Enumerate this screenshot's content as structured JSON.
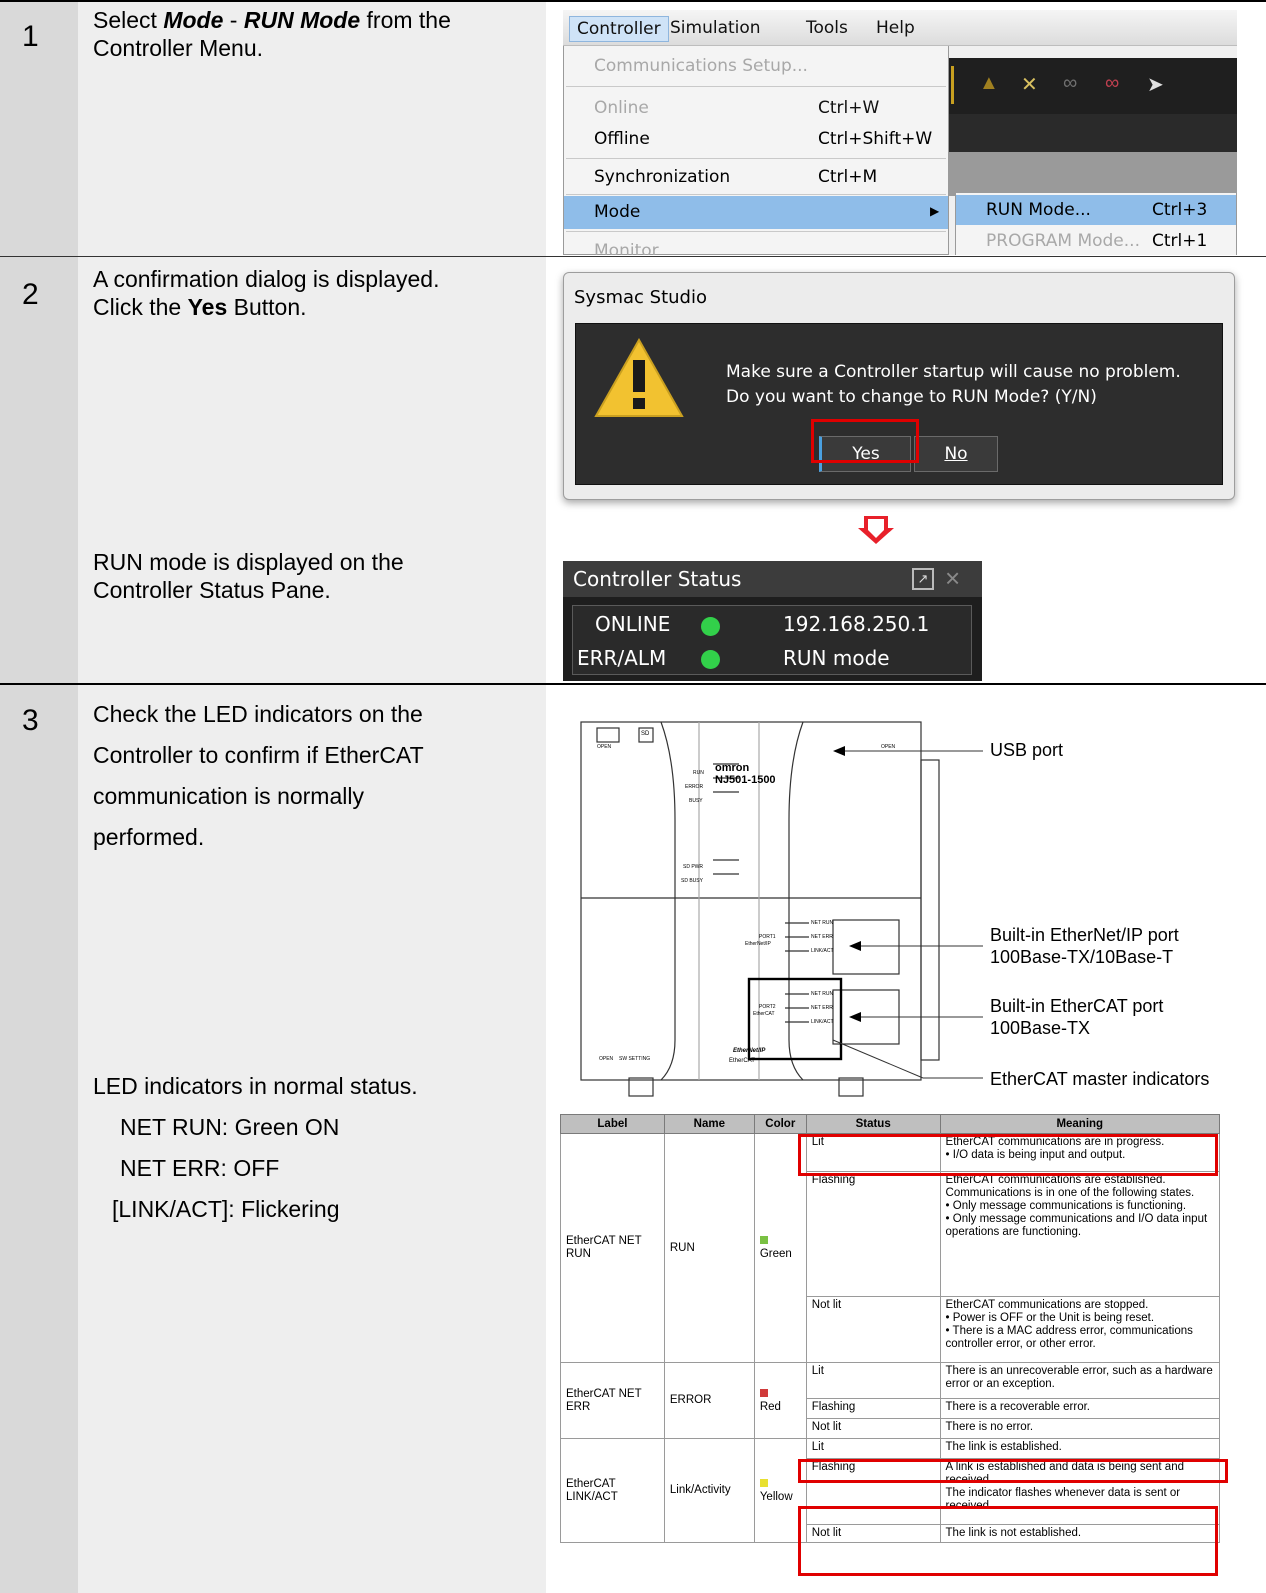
{
  "steps": [
    {
      "number": "1",
      "text_pre": "Select ",
      "text_bold1": "Mode",
      "text_sep": " - ",
      "text_bold2": "RUN Mode",
      "text_post": " from the",
      "text_line2": "Controller Menu."
    },
    {
      "number": "2",
      "text_line1": "A confirmation dialog is displayed.",
      "text_pre": "Click the ",
      "text_bold": "Yes",
      "text_post": " Button.",
      "result_line1": "RUN mode is displayed on the",
      "result_line2": "Controller Status Pane."
    },
    {
      "number": "3",
      "lines": [
        "Check the LED indicators on the",
        "Controller to confirm if EtherCAT",
        "communication is normally",
        "performed."
      ],
      "normal_title": "LED indicators in normal status.",
      "normal_items": [
        "NET RUN: Green ON",
        "NET ERR: OFF",
        "[LINK/ACT]: Flickering"
      ]
    }
  ],
  "menu": {
    "bar": [
      "Controller",
      "Simulation",
      "Tools",
      "Help"
    ],
    "items": [
      {
        "label": "Communications Setup...",
        "shortcut": ""
      },
      {
        "label": "Online",
        "shortcut": "Ctrl+W"
      },
      {
        "label": "Offline",
        "shortcut": "Ctrl+Shift+W"
      },
      {
        "label": "Synchronization",
        "shortcut": "Ctrl+M"
      },
      {
        "label": "Mode",
        "shortcut": ""
      },
      {
        "label": "Monitor",
        "shortcut": ""
      }
    ],
    "submenu": [
      {
        "label": "RUN Mode...",
        "shortcut": "Ctrl+3"
      },
      {
        "label": "PROGRAM Mode...",
        "shortcut": "Ctrl+1"
      }
    ]
  },
  "dialog": {
    "title": "Sysmac Studio",
    "message_line1": "Make sure a Controller startup will cause no problem.",
    "message_line2": "Do you want to change to RUN Mode? (Y/N)",
    "yes": "Yes",
    "no": "No"
  },
  "status_pane": {
    "title": "Controller Status",
    "online_label": "ONLINE",
    "ip": "192.168.250.1",
    "err_label": "ERR/ALM",
    "mode": "RUN mode"
  },
  "hardware": {
    "brand": "omron",
    "model": "NJ501-1500",
    "callouts": {
      "usb": "USB port",
      "eip_line1": "Built-in EtherNet/IP port",
      "eip_line2": "100Base-TX/10Base-T",
      "ecat_line1": "Built-in EtherCAT port",
      "ecat_line2": "100Base-TX",
      "indicators": "EtherCAT master indicators"
    },
    "labels": {
      "open": "OPEN",
      "sd": "SD",
      "run": "RUN",
      "error": "ERROR",
      "busy": "BUSY",
      "sdpwr": "SD PWR",
      "sdbusy": "SD BUSY",
      "netrun": "NET RUN",
      "neterr": "NET ERR",
      "linkact": "LINK/ACT",
      "port1": "PORT1",
      "port1b": "EtherNet/IP",
      "port2": "PORT2",
      "port2b": "EtherCAT",
      "swsetting": "SW SETTING",
      "logo1": "EtherNet/IP",
      "logo2": "EtherCAT"
    }
  },
  "led_table": {
    "headers": [
      "Label",
      "Name",
      "Color",
      "Status",
      "Meaning"
    ],
    "rows": {
      "r1_label": "EtherCAT NET RUN",
      "r1_name": "RUN",
      "r1_color": "Green",
      "r1_lit": "Lit",
      "r1_lit_m1": "EtherCAT communications are in progress.",
      "r1_lit_m2": "• I/O data is being input and output.",
      "r1_flash": "Flashing",
      "r1_flash_m1": "EtherCAT communications are established. Communications is in one of the following states.",
      "r1_flash_m2": "• Only message communications is functioning.",
      "r1_flash_m3": "• Only message communications and I/O data input operations are functioning.",
      "r1_notlit": "Not lit",
      "r1_notlit_m1": "EtherCAT communications are stopped.",
      "r1_notlit_m2": "• Power is OFF or the Unit is being reset.",
      "r1_notlit_m3": "• There is a MAC address error, communications controller error, or other error.",
      "r2_label": "EtherCAT NET ERR",
      "r2_name": "ERROR",
      "r2_color": "Red",
      "r2_lit": "Lit",
      "r2_lit_m": "There is an unrecoverable error, such as a hardware error or an exception.",
      "r2_flash": "Flashing",
      "r2_flash_m": "There is a recoverable error.",
      "r2_notlit": "Not lit",
      "r2_notlit_m": "There is no error.",
      "r3_label": "EtherCAT LINK/ACT",
      "r3_name": "Link/Activity",
      "r3_color": "Yellow",
      "r3_lit": "Lit",
      "r3_lit_m": "The link is established.",
      "r3_flash": "Flashing",
      "r3_flash_m1": "A link is established and data is being sent and received.",
      "r3_flash_m2": "The indicator flashes whenever data is sent or received.",
      "r3_notlit": "Not lit",
      "r3_notlit_m": "The link is not established."
    }
  },
  "colors": {
    "highlight_red": "#e00000",
    "arrow_red": "#e8202a",
    "led_green": "#32d04a"
  }
}
